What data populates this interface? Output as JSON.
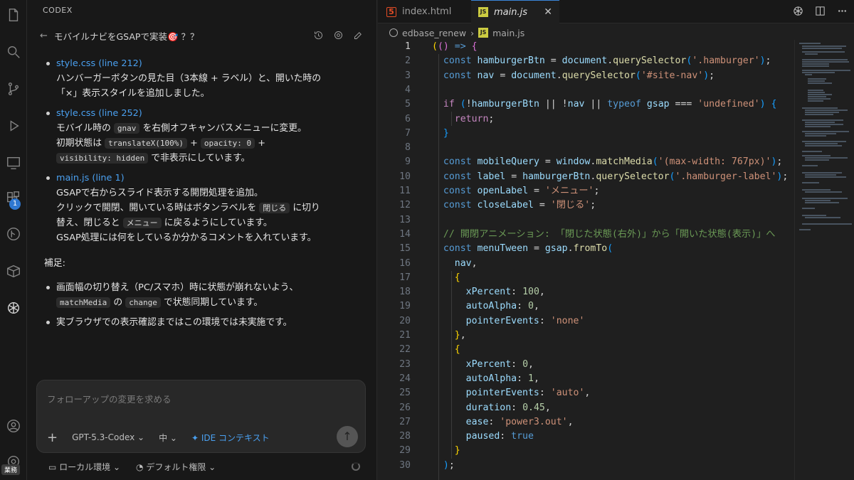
{
  "chat": {
    "header": "CODEX",
    "title": "モバイルナビをGSAPで実装🎯 ？？",
    "items": [
      {
        "file": "style.css (line 212)",
        "line1": "ハンバーガーボタンの見た目（3本線 + ラベル）と、開いた時の",
        "line2": "「×」表示スタイルを追加しました。"
      },
      {
        "file": "style.css (line 252)",
        "line1_a": "モバイル時の",
        "code_gnav": "gnav",
        "line1_b": "を右側オフキャンバスメニューに変更。",
        "line2_a": "初期状態は",
        "code_translate": "translateX(100%)",
        "plus1": "+",
        "code_opacity": "opacity: 0",
        "plus2": "+",
        "code_visibility": "visibility: hidden",
        "line3_b": "で非表示にしています。"
      },
      {
        "file": "main.js (line 1)",
        "line1": "GSAPで右からスライド表示する開閉処理を追加。",
        "line2_a": "クリックで開閉、開いている時はボタンラベルを",
        "code_close": "閉じる",
        "line2_b": "に切り",
        "line3_a": "替え、閉じると",
        "code_menu": "メニュー",
        "line3_b": "に戻るようにしています。",
        "line4": "GSAP処理には何をしているか分かるコメントを入れています。"
      }
    ],
    "supplement_label": "補足:",
    "notes": [
      {
        "line1": "画面幅の切り替え（PC/スマホ）時に状態が崩れないよう、",
        "code_match": "matchMedia",
        "mid": "の",
        "code_change": "change",
        "line2_b": "で状態同期しています。"
      },
      {
        "line1": "実ブラウザでの表示確認まではこの環境では未実施です。"
      }
    ],
    "input_placeholder": "フォローアップの変更を求める",
    "model": "GPT-5.3-Codex ⌄",
    "effort": "中 ⌄",
    "ide_context": "IDE コンテキスト",
    "local_env": "ローカル環境 ⌄",
    "default_perm": "デフォルト権限 ⌄",
    "extension_badge": "1",
    "tag_label": "業務"
  },
  "editor": {
    "tab_html": "index.html",
    "tab_js": "main.js",
    "breadcrumb_root": "edbase_renew",
    "breadcrumb_file": "main.js",
    "current_line": 1,
    "lines": [
      "1",
      "2",
      "3",
      "4",
      "5",
      "6",
      "7",
      "8",
      "9",
      "10",
      "11",
      "12",
      "13",
      "14",
      "15",
      "16",
      "17",
      "18",
      "19",
      "20",
      "21",
      "22",
      "23",
      "24",
      "25",
      "26",
      "27",
      "28",
      "29",
      "30"
    ]
  },
  "colors": {
    "accent": "#4aa0f0",
    "badge": "#2f78d1",
    "keyword": "#569cd6",
    "string": "#ce9178"
  }
}
